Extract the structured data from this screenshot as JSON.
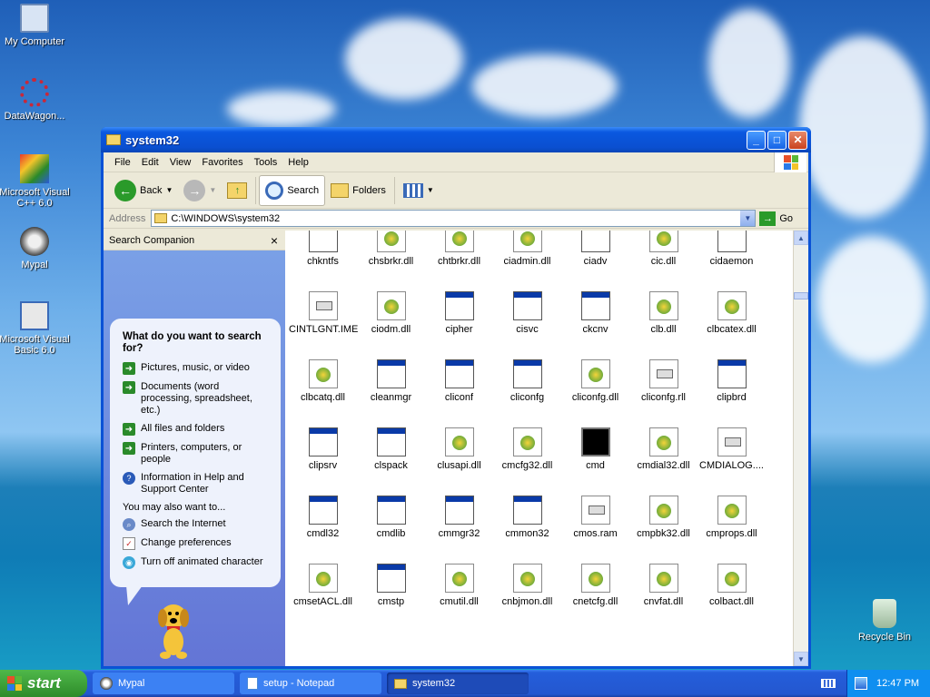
{
  "desktop": {
    "icons": [
      {
        "label": "My Computer",
        "icon": "my-computer-icon"
      },
      {
        "label": "DataWagon...",
        "icon": "datawagon-icon"
      },
      {
        "label": "Microsoft Visual C++ 6.0",
        "icon": "visual-cpp-icon"
      },
      {
        "label": "Mypal",
        "icon": "mypal-icon"
      },
      {
        "label": "Microsoft Visual Basic 6.0",
        "icon": "visual-basic-icon"
      },
      {
        "label": "Recycle Bin",
        "icon": "recycle-bin-icon"
      }
    ]
  },
  "window": {
    "title": "system32",
    "menu": [
      "File",
      "Edit",
      "View",
      "Favorites",
      "Tools",
      "Help"
    ],
    "toolbar": {
      "back": "Back",
      "search": "Search",
      "folders": "Folders"
    },
    "address": {
      "label": "Address",
      "value": "C:\\WINDOWS\\system32",
      "go": "Go"
    }
  },
  "companion": {
    "header": "Search Companion",
    "close": "×",
    "question": "What do you want to search for?",
    "options": [
      "Pictures, music, or video",
      "Documents (word processing, spreadsheet, etc.)",
      "All files and folders",
      "Printers, computers, or people",
      "Information in Help and Support Center"
    ],
    "also_label": "You may also want to...",
    "also": [
      "Search the Internet",
      "Change preferences",
      "Turn off animated character"
    ]
  },
  "files": [
    {
      "name": "chkntfs",
      "type": "app"
    },
    {
      "name": "chsbrkr.dll",
      "type": "dll"
    },
    {
      "name": "chtbrkr.dll",
      "type": "dll"
    },
    {
      "name": "ciadmin.dll",
      "type": "dll"
    },
    {
      "name": "ciadv",
      "type": "app"
    },
    {
      "name": "cic.dll",
      "type": "dll"
    },
    {
      "name": "cidaemon",
      "type": "app"
    },
    {
      "name": "CINTLGNT.IME",
      "type": "doc"
    },
    {
      "name": "ciodm.dll",
      "type": "dll"
    },
    {
      "name": "cipher",
      "type": "app"
    },
    {
      "name": "cisvc",
      "type": "app"
    },
    {
      "name": "ckcnv",
      "type": "app"
    },
    {
      "name": "clb.dll",
      "type": "dll"
    },
    {
      "name": "clbcatex.dll",
      "type": "dll"
    },
    {
      "name": "clbcatq.dll",
      "type": "dll"
    },
    {
      "name": "cleanmgr",
      "type": "app"
    },
    {
      "name": "cliconf",
      "type": "app"
    },
    {
      "name": "cliconfg",
      "type": "app"
    },
    {
      "name": "cliconfg.dll",
      "type": "dll"
    },
    {
      "name": "cliconfg.rll",
      "type": "doc"
    },
    {
      "name": "clipbrd",
      "type": "app"
    },
    {
      "name": "clipsrv",
      "type": "app"
    },
    {
      "name": "clspack",
      "type": "app"
    },
    {
      "name": "clusapi.dll",
      "type": "dll"
    },
    {
      "name": "cmcfg32.dll",
      "type": "dll"
    },
    {
      "name": "cmd",
      "type": "cmd"
    },
    {
      "name": "cmdial32.dll",
      "type": "dll"
    },
    {
      "name": "CMDIALOG....",
      "type": "doc"
    },
    {
      "name": "cmdl32",
      "type": "app"
    },
    {
      "name": "cmdlib",
      "type": "app"
    },
    {
      "name": "cmmgr32",
      "type": "app"
    },
    {
      "name": "cmmon32",
      "type": "app"
    },
    {
      "name": "cmos.ram",
      "type": "doc"
    },
    {
      "name": "cmpbk32.dll",
      "type": "dll"
    },
    {
      "name": "cmprops.dll",
      "type": "dll"
    },
    {
      "name": "cmsetACL.dll",
      "type": "dll"
    },
    {
      "name": "cmstp",
      "type": "app"
    },
    {
      "name": "cmutil.dll",
      "type": "dll"
    },
    {
      "name": "cnbjmon.dll",
      "type": "dll"
    },
    {
      "name": "cnetcfg.dll",
      "type": "dll"
    },
    {
      "name": "cnvfat.dll",
      "type": "dll"
    },
    {
      "name": "colbact.dll",
      "type": "dll"
    }
  ],
  "taskbar": {
    "start": "start",
    "tasks": [
      "Mypal",
      "setup - Notepad",
      "system32"
    ],
    "clock": "12:47 PM"
  }
}
